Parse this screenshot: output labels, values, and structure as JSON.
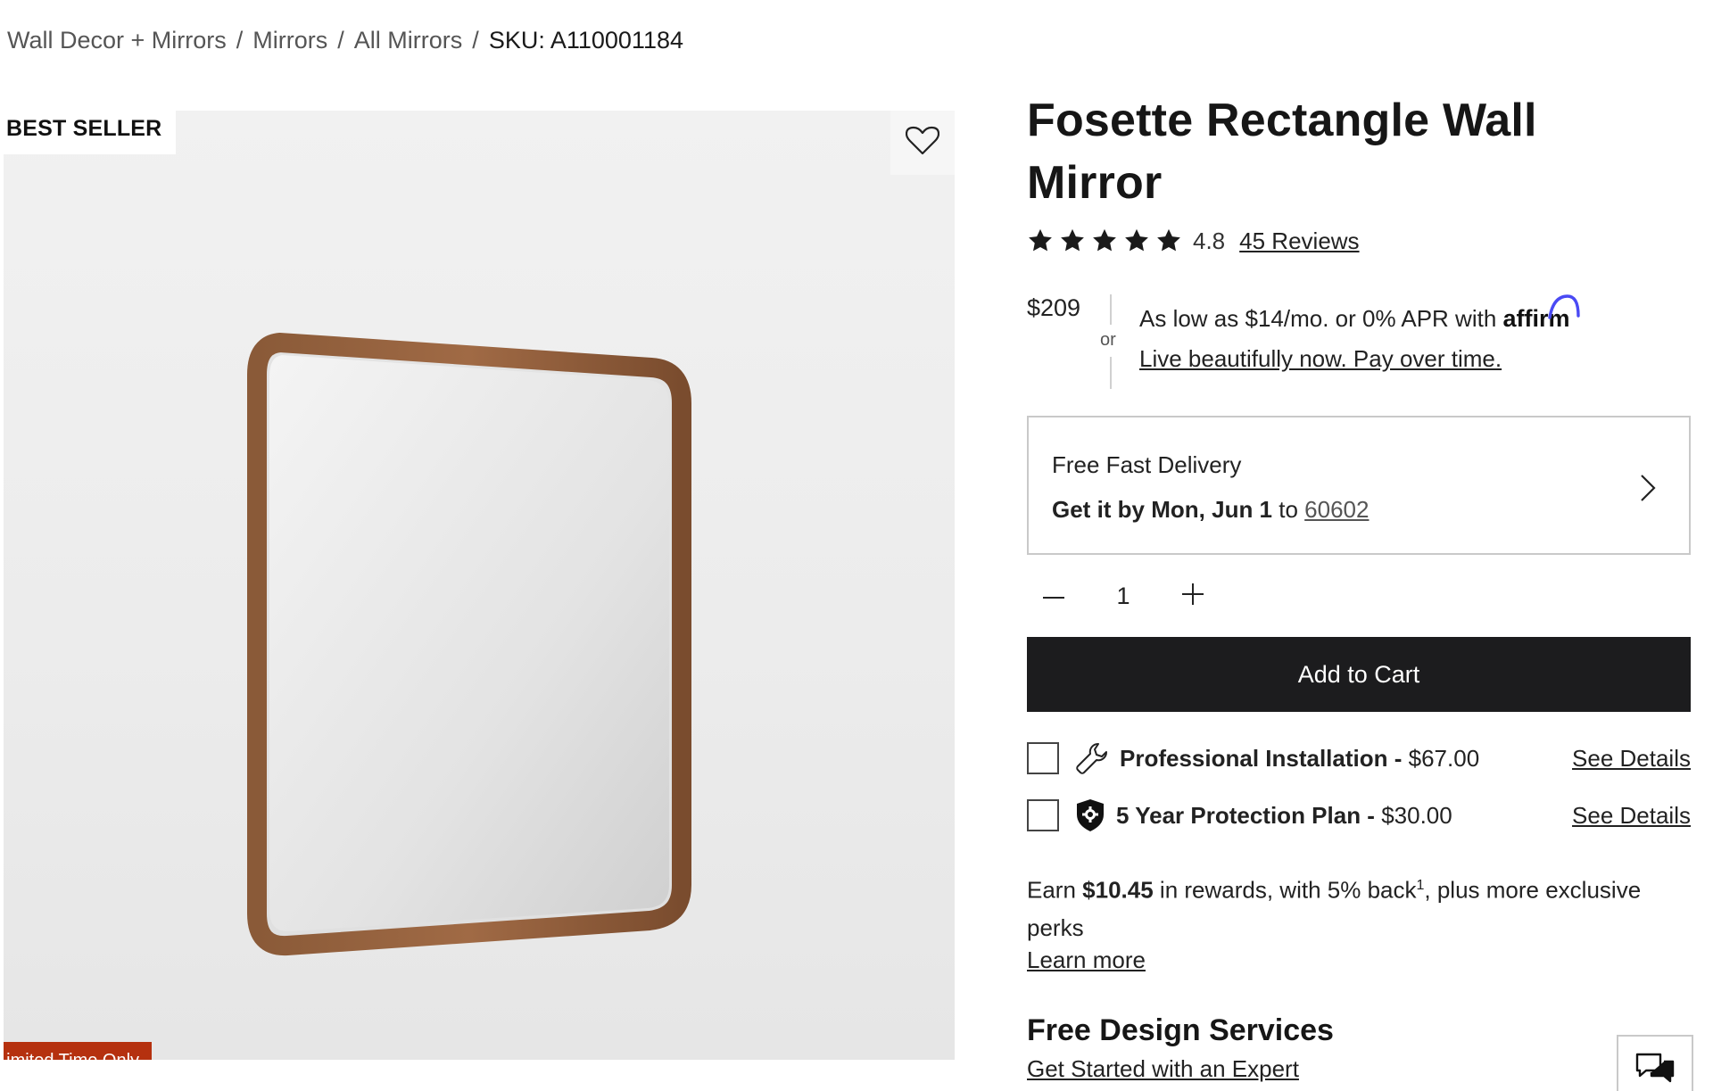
{
  "breadcrumb": {
    "items": [
      "Wall Decor + Mirrors",
      "Mirrors",
      "All Mirrors"
    ],
    "separator": "/",
    "sku": "SKU: A110001184"
  },
  "gallery": {
    "badge_top": "BEST SELLER",
    "badge_bottom": "Limited Time Only",
    "favorite_icon": "heart-outline-icon",
    "image_subject": "mirror-image"
  },
  "product": {
    "title": "Fosette Rectangle Wall Mirror",
    "rating": {
      "value": "4.8",
      "stars": 5,
      "reviews_label": "45 Reviews"
    },
    "price": "$209",
    "financing": {
      "or_label": "or",
      "text": "As low as $14/mo. or 0% APR with",
      "brand": "affirm",
      "promo_link": "Live beautifully now. Pay over time."
    },
    "delivery": {
      "heading": "Free Fast Delivery",
      "date_bold": "Get it by Mon, Jun 1",
      "to_label": "to",
      "zip": "60602"
    },
    "quantity": {
      "value": "1",
      "minus": "–",
      "plus": "+"
    },
    "add_to_cart_label": "Add to Cart",
    "addons": [
      {
        "icon": "wrench-icon",
        "label_bold": "Professional Installation -",
        "price": "$67.00",
        "details": "See Details"
      },
      {
        "icon": "shield-icon",
        "label_bold": "5 Year Protection Plan -",
        "price": "$30.00",
        "details": "See Details"
      }
    ],
    "rewards": {
      "prefix": "Earn",
      "amount": "$10.45",
      "middle": "in rewards, with 5% back",
      "superscript": "1",
      "suffix": ", plus more exclusive perks",
      "learn_more": "Learn more"
    },
    "design_services": {
      "title": "Free Design Services",
      "link": "Get Started with an Expert"
    }
  },
  "chat": {
    "icon": "chat-bubbles-icon"
  },
  "colors": {
    "primary_button": "#1c1c1e",
    "limited_badge": "#b5310f",
    "border": "#c9c9c9",
    "affirm_arc": "#4a4af4"
  }
}
